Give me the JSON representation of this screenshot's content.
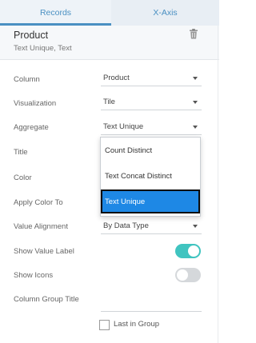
{
  "tabs": {
    "records": "Records",
    "xaxis": "X-Axis"
  },
  "header": {
    "title": "Product",
    "subtitle": "Text Unique, Text"
  },
  "fields": {
    "column": {
      "label": "Column",
      "value": "Product"
    },
    "visualization": {
      "label": "Visualization",
      "value": "Tile"
    },
    "aggregate": {
      "label": "Aggregate",
      "value": "Text Unique"
    },
    "title": {
      "label": "Title"
    },
    "color": {
      "label": "Color"
    },
    "apply_color_to": {
      "label": "Apply Color To"
    },
    "value_alignment": {
      "label": "Value Alignment",
      "value": "By Data Type"
    },
    "show_value_label": {
      "label": "Show Value Label",
      "on": true
    },
    "show_icons": {
      "label": "Show Icons",
      "on": false
    },
    "column_group_title": {
      "label": "Column Group Title"
    },
    "last_in_group": {
      "label": "Last in Group",
      "checked": false
    }
  },
  "aggregate_options": [
    "Count Distinct",
    "Text Concat Distinct",
    "Text Unique"
  ],
  "aggregate_selected": "Text Unique",
  "icons": {
    "delete": "trash-icon",
    "dropdown": "caret-down-icon"
  },
  "colors": {
    "accent": "#4a90c2",
    "toggle_on": "#40c4c0",
    "selected_option": "#1e88e5"
  }
}
